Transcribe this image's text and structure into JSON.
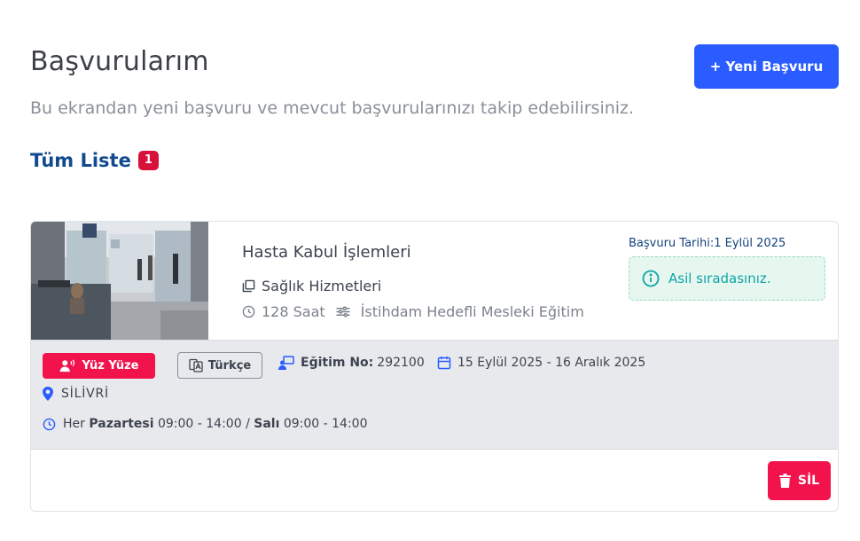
{
  "header": {
    "title": "Başvurularım",
    "subtitle": "Bu ekrandan yeni başvuru ve mevcut başvurularınızı takip edebilirsiniz.",
    "new_button": "+ Yeni Başvuru"
  },
  "list": {
    "heading": "Tüm Liste",
    "count": "1"
  },
  "application": {
    "course_title": "Hasta Kabul İşlemleri",
    "category": "Sağlık Hizmetleri",
    "duration": "128 Saat",
    "program_type": "İstihdam Hedefli Mesleki Eğitim",
    "application_date": "Başvuru Tarihi:1 Eylül 2025",
    "status": "Asil sıradasınız.",
    "mode": "Yüz Yüze",
    "language": "Türkçe",
    "training_no_label": "Eğitim No:",
    "training_no": "292100",
    "date_range": "15 Eylül 2025 - 16 Aralık 2025",
    "location": "SİLİVRİ",
    "schedule": {
      "prefix": "Her",
      "day1": "Pazartesi",
      "time1": "09:00 - 14:00",
      "sep": "/",
      "day2": "Salı",
      "time2": "09:00 - 14:00"
    },
    "delete_button": "SİL"
  },
  "colors": {
    "primary": "#2a5cff",
    "danger": "#f2134d",
    "heading": "#114a8f",
    "status_text": "#0fa4a8",
    "status_bg": "#e6f7ef"
  }
}
